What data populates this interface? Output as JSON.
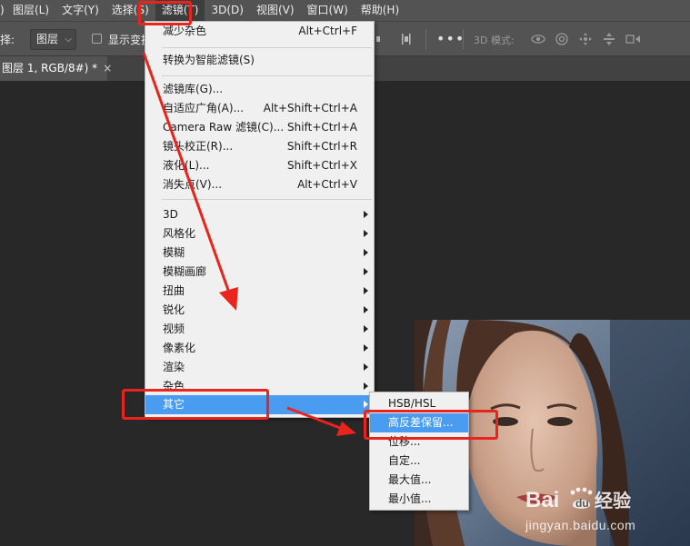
{
  "menubar": {
    "items": [
      "图层(L)",
      "文字(Y)",
      "选择(S)",
      "滤镜(T)",
      "3D(D)",
      "视图(V)",
      "窗口(W)",
      "帮助(H)"
    ]
  },
  "options": {
    "select_label": "择:",
    "layer_select": "图层",
    "show_transform": "显示变换",
    "more": "•••",
    "mode_3d": "3D 模式:"
  },
  "document": {
    "tab_title": "图层 1, RGB/8#) *",
    "close": "×"
  },
  "filter_menu": {
    "last_filter": {
      "label": "减少杂色",
      "shortcut": "Alt+Ctrl+F"
    },
    "smart": {
      "label": "转换为智能滤镜(S)"
    },
    "gallery": [
      {
        "label": "滤镜库(G)...",
        "shortcut": ""
      },
      {
        "label": "自适应广角(A)...",
        "shortcut": "Alt+Shift+Ctrl+A"
      },
      {
        "label": "Camera Raw 滤镜(C)...",
        "shortcut": "Shift+Ctrl+A"
      },
      {
        "label": "镜头校正(R)...",
        "shortcut": "Shift+Ctrl+R"
      },
      {
        "label": "液化(L)...",
        "shortcut": "Shift+Ctrl+X"
      },
      {
        "label": "消失点(V)...",
        "shortcut": "Alt+Ctrl+V"
      }
    ],
    "submenus": [
      "3D",
      "风格化",
      "模糊",
      "模糊画廊",
      "扭曲",
      "锐化",
      "视频",
      "像素化",
      "渲染",
      "杂色",
      "其它"
    ]
  },
  "other_submenu": {
    "items": [
      "HSB/HSL",
      "高反差保留...",
      "位移...",
      "自定...",
      "最大值...",
      "最小值..."
    ],
    "highlighted": "高反差保留..."
  },
  "watermark": {
    "logo": "Bai du 经验",
    "url": "jingyan.baidu.com"
  },
  "colors": {
    "menu_highlight": "#4a9cf0",
    "annotation_red": "#e8241c",
    "panel": "#535353",
    "canvas": "#282828"
  }
}
